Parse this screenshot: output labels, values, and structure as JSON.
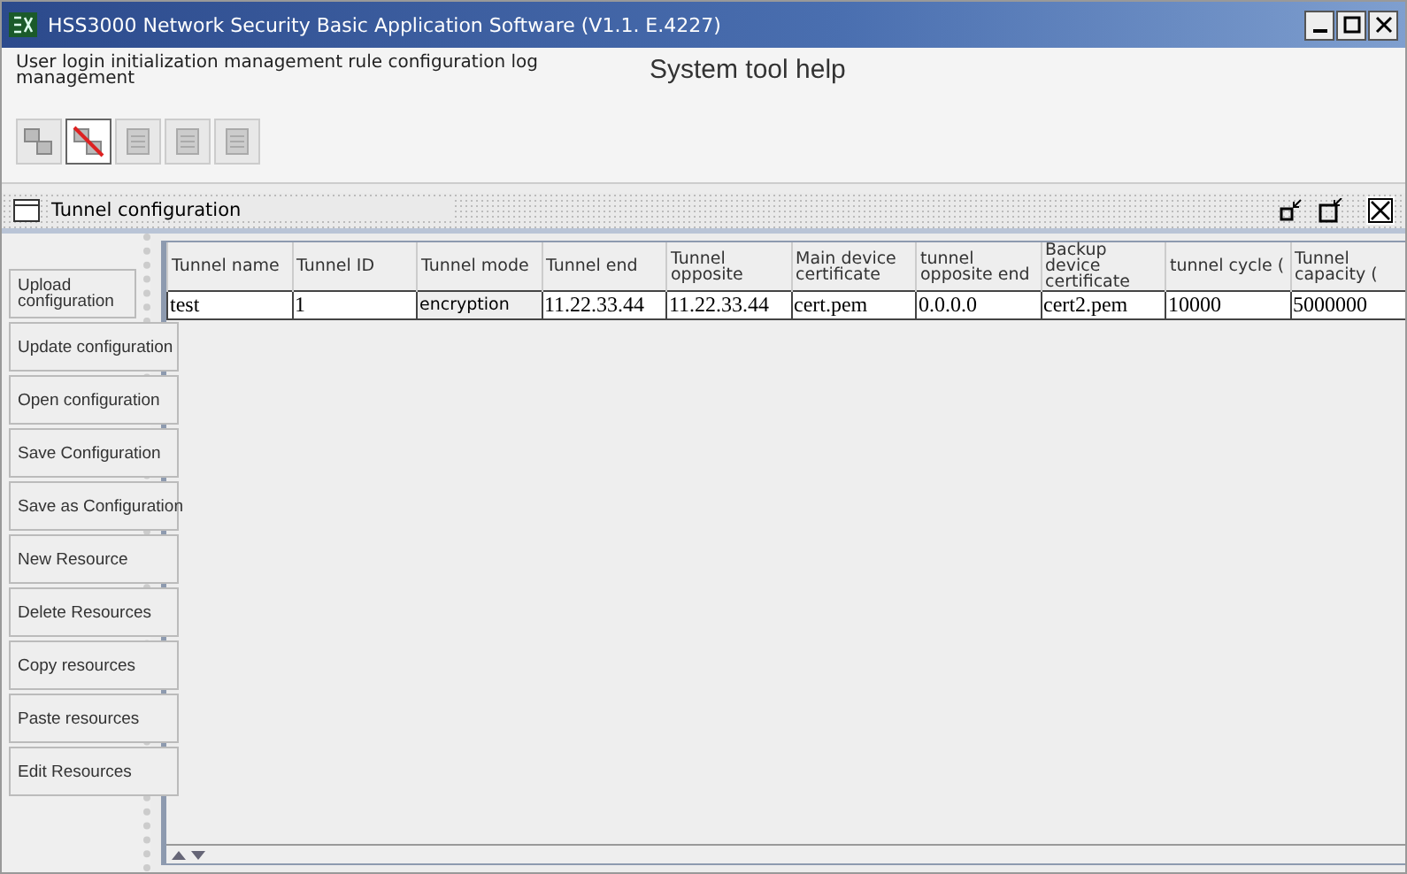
{
  "window": {
    "title": "HSS3000 Network Security Basic Application Software (V1.1. E.4227)"
  },
  "menu": {
    "left": "User login initialization management rule configuration log management",
    "right": "System tool help"
  },
  "toolbar": [
    {
      "selected": false
    },
    {
      "selected": true
    },
    {
      "selected": false
    },
    {
      "selected": false
    },
    {
      "selected": false
    }
  ],
  "frame": {
    "title": "Tunnel configuration"
  },
  "actions": [
    "Upload configuration",
    "Update configuration",
    "Open configuration",
    "Save Configuration",
    "Save as Configuration",
    "New Resource",
    "Delete Resources",
    "Copy resources",
    "Paste resources",
    "Edit Resources"
  ],
  "table": {
    "columns": [
      "Tunnel name",
      "Tunnel ID",
      "Tunnel mode",
      "Tunnel end",
      "Tunnel opposite",
      "Main device certificate",
      "tunnel opposite end",
      "Backup device certificate",
      "tunnel cycle (",
      "Tunnel capacity ("
    ],
    "rows": [
      [
        "test",
        "1",
        "encryption",
        "11.22.33.44",
        "11.22.33.44",
        "cert.pem",
        "0.0.0.0",
        "cert2.pem",
        "10000",
        "5000000"
      ]
    ]
  }
}
